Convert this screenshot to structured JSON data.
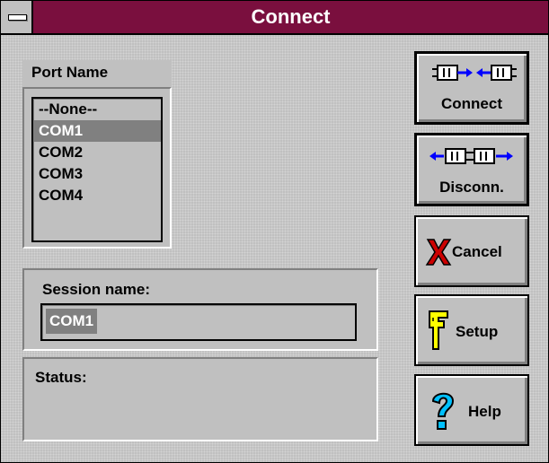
{
  "window": {
    "title": "Connect"
  },
  "port_list": {
    "header": "Port Name",
    "items": [
      "--None--",
      "COM1",
      "COM2",
      "COM3",
      "COM4"
    ],
    "selected": "COM1"
  },
  "session": {
    "label": "Session name:",
    "value": "COM1"
  },
  "status": {
    "label": "Status:",
    "value": ""
  },
  "buttons": {
    "connect": "Connect",
    "disconnect": "Disconn.",
    "cancel": "Cancel",
    "setup": "Setup",
    "help": "Help"
  },
  "colors": {
    "titlebar": "#7a0f3e",
    "face": "#c0c0c0",
    "selection": "#808080",
    "connector_arrow": "#0000ff",
    "cancel_x": "#cc0000",
    "setup_icon": "#ffff00",
    "help_icon": "#00c0ff"
  },
  "icons": {
    "sysmenu": "system-menu-icon",
    "connect": "plug-connect-icon",
    "disconnect": "plug-disconnect-icon",
    "cancel": "red-x-icon",
    "setup": "wrench-icon",
    "help": "question-mark-icon"
  }
}
